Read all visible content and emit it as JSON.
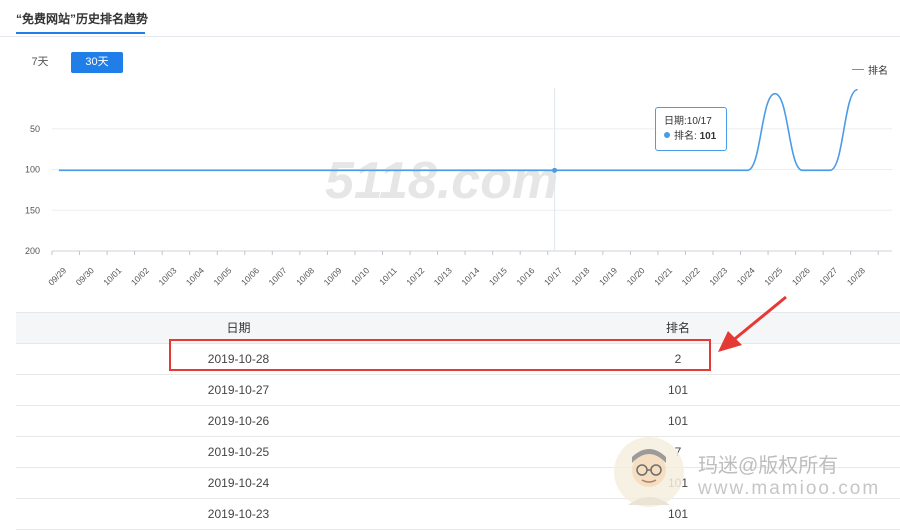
{
  "tab": {
    "title": "“免费网站”历史排名趋势"
  },
  "ranges": {
    "r7": "7天",
    "r30": "30天",
    "active": "30天"
  },
  "legend": {
    "label": "排名"
  },
  "tooltip": {
    "date_label": "日期:10/17",
    "rank_label": "排名: ",
    "rank_value": "101"
  },
  "table": {
    "headers": {
      "date": "日期",
      "rank": "排名"
    },
    "rows": [
      {
        "date": "2019-10-28",
        "rank": "2"
      },
      {
        "date": "2019-10-27",
        "rank": "101"
      },
      {
        "date": "2019-10-26",
        "rank": "101"
      },
      {
        "date": "2019-10-25",
        "rank": "7"
      },
      {
        "date": "2019-10-24",
        "rank": "101"
      },
      {
        "date": "2019-10-23",
        "rank": "101"
      }
    ]
  },
  "watermark": {
    "line1": "玛迷@版权所有",
    "line2": "www.mamioo.com",
    "logo_text": "5118.com"
  },
  "colors": {
    "accent": "#1f7ee8",
    "series": "#4a9be8",
    "highlight": "#e53935",
    "arrow": "#e53935"
  },
  "chart_data": {
    "type": "line",
    "x": [
      "09/29",
      "09/30",
      "10/01",
      "10/02",
      "10/03",
      "10/04",
      "10/05",
      "10/06",
      "10/07",
      "10/08",
      "10/09",
      "10/10",
      "10/11",
      "10/12",
      "10/13",
      "10/14",
      "10/15",
      "10/16",
      "10/17",
      "10/18",
      "10/19",
      "10/20",
      "10/21",
      "10/22",
      "10/23",
      "10/24",
      "10/25",
      "10/26",
      "10/27",
      "10/28"
    ],
    "series": [
      {
        "name": "排名",
        "values": [
          101,
          101,
          101,
          101,
          101,
          101,
          101,
          101,
          101,
          101,
          101,
          101,
          101,
          101,
          101,
          101,
          101,
          101,
          101,
          101,
          101,
          101,
          101,
          101,
          101,
          101,
          7,
          101,
          101,
          2
        ]
      }
    ],
    "y_ticks": [
      "50",
      "100",
      "150",
      "200"
    ],
    "ylim": [
      200,
      0
    ],
    "y_inverted": true,
    "highlighted_x": "10/17",
    "legend_position": "top-right",
    "grid": true
  }
}
